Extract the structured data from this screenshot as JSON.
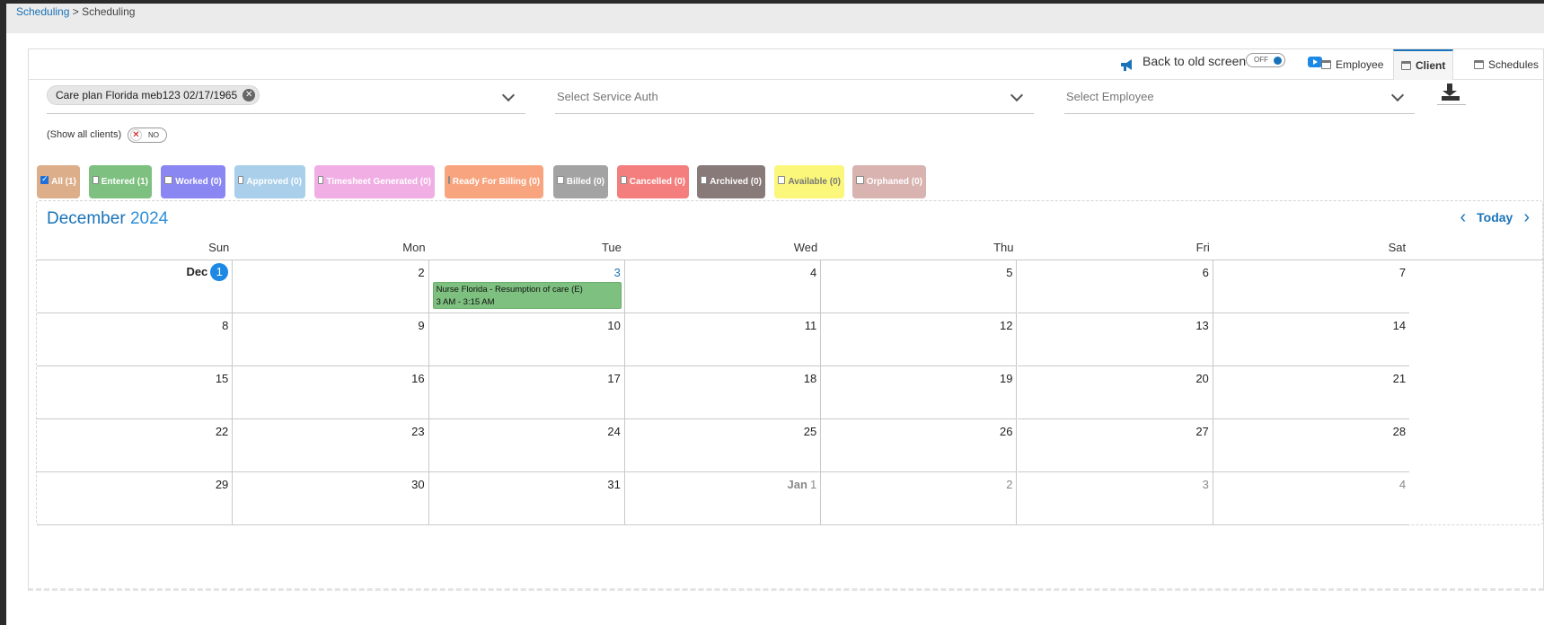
{
  "breadcrumb": {
    "link": "Scheduling",
    "separator": " > ",
    "current": "Scheduling"
  },
  "topnav": {
    "old_screen_label": "Back to old screen",
    "toggle_label": "OFF",
    "tabs": [
      {
        "label": "Employee",
        "icon": "calendar-icon",
        "active": false
      },
      {
        "label": "Client",
        "icon": "calendar-icon",
        "active": true
      },
      {
        "label": "Schedules",
        "icon": "calendar-icon",
        "active": false
      }
    ]
  },
  "selects": {
    "client_chip": "Care plan Florida meb123 02/17/1965",
    "service_auth_placeholder": "Select Service Auth",
    "employee_placeholder": "Select Employee"
  },
  "show_all": {
    "label": "(Show all clients)",
    "toggle": "NO"
  },
  "filters": [
    {
      "label": "All (1)",
      "color": "#dcae8a",
      "checked": true
    },
    {
      "label": "Entered (1)",
      "color": "#7dc07f",
      "checked": false
    },
    {
      "label": "Worked (0)",
      "color": "#8a86f2",
      "checked": false
    },
    {
      "label": "Approved (0)",
      "color": "#a9cfea",
      "checked": false
    },
    {
      "label": "Timesheet Generated (0)",
      "color": "#f0aee4",
      "checked": false
    },
    {
      "label": "Ready For Billing (0)",
      "color": "#f8a57f",
      "checked": false
    },
    {
      "label": "Billed (0)",
      "color": "#a3a3a3",
      "checked": false
    },
    {
      "label": "Cancelled (0)",
      "color": "#f47d7d",
      "checked": false
    },
    {
      "label": "Archived (0)",
      "color": "#877a78",
      "checked": false
    },
    {
      "label": "Available (0)",
      "color": "#fbf77a",
      "checked": false
    },
    {
      "label": "Orphaned (0)",
      "color": "#d8b3b0",
      "checked": false
    }
  ],
  "calendar": {
    "month": "December",
    "year": "2024",
    "today_label": "Today",
    "days_of_week": [
      "Sun",
      "Mon",
      "Tue",
      "Wed",
      "Thu",
      "Fri",
      "Sat"
    ],
    "weeks": [
      [
        "1",
        "2",
        "3",
        "4",
        "5",
        "6",
        "7"
      ],
      [
        "8",
        "9",
        "10",
        "11",
        "12",
        "13",
        "14"
      ],
      [
        "15",
        "16",
        "17",
        "18",
        "19",
        "20",
        "21"
      ],
      [
        "22",
        "23",
        "24",
        "25",
        "26",
        "27",
        "28"
      ],
      [
        "29",
        "30",
        "31",
        "1",
        "2",
        "3",
        "4"
      ]
    ],
    "dec_label": "Dec",
    "jan_label": "Jan",
    "event": {
      "title": "Nurse Florida - Resumption of care (E)",
      "time": "3 AM - 3:15 AM",
      "color": "#7dc07f"
    }
  }
}
